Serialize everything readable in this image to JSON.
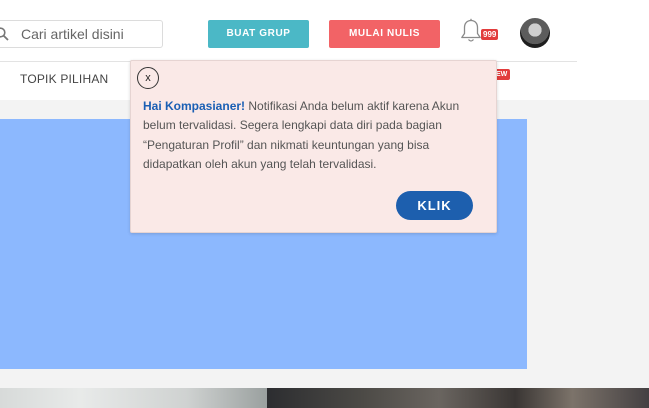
{
  "header": {
    "search": {
      "placeholder": "Cari artikel disini",
      "value": "",
      "icon": "search-icon"
    },
    "buttons": {
      "buat_grup": "BUAT GRUP",
      "mulai_nulis": "MULAI NULIS"
    },
    "notifications": {
      "icon": "bell-icon",
      "badge": "999"
    },
    "avatar": {
      "icon": "user-avatar"
    }
  },
  "nav": {
    "items": [
      {
        "label": "TOPIK PILIHAN"
      }
    ],
    "new_badge": "EW"
  },
  "popup": {
    "close_label": "x",
    "greeting": "Hai Kompasianer!",
    "message": " Notifikasi Anda belum aktif karena Akun belum tervalidasi. Segera lengkapi data diri pada bagian “Pengaturan Profil” dan nikmati keuntungan yang bisa didapatkan oleh akun yang telah tervalidasi.",
    "button_label": "KLIK"
  },
  "colors": {
    "buat_grup": "#4bb8c6",
    "mulai_nulis": "#f26366",
    "badge": "#e23c3c",
    "popup_background": "#fae9e7",
    "popup_accent": "#1d5fae",
    "banner": "#8cb8fe"
  }
}
